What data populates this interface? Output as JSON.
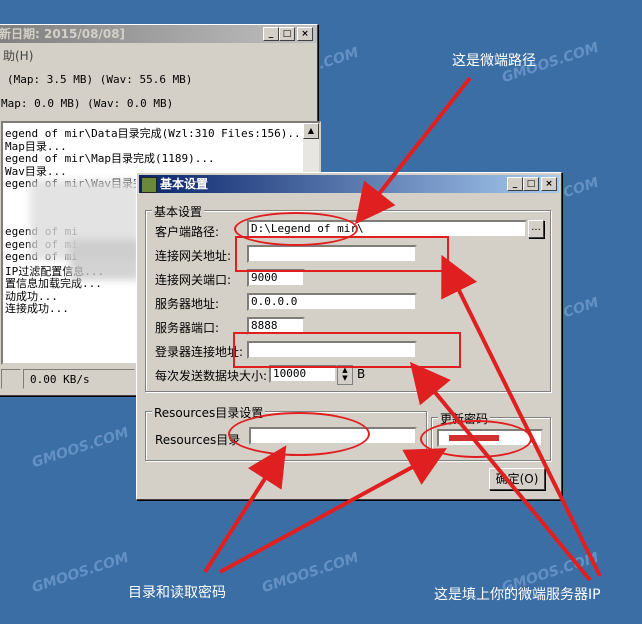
{
  "bg_window": {
    "title": "新日期: 2015/08/08]",
    "menu": "助(H)",
    "stat1": "(Map: 3.5 MB) (Wav: 55.6 MB)",
    "stat2": "Map: 0.0 MB) (Wav: 0.0 MB)",
    "log": [
      "egend of mir\\Data目录完成(Wzl:310 Files:156)...",
      "Map目录...",
      "egend of mir\\Map目录完成(1189)...",
      "Wav目录...",
      "egend of mir\\Wav目录完成(",
      "",
      "",
      "",
      "egend of mi",
      "egend of mi",
      "egend of mi",
      "IP过滤配置信息...",
      "置信息加载完成...",
      "动成功...",
      "连接成功..."
    ],
    "speed": "0.00 KB/s"
  },
  "dialog": {
    "title": "基本设置",
    "basic_group": "基本设置",
    "client_path_label": "客户端路径:",
    "client_path_value": "D:\\Legend of mir\\",
    "browse_btn": "...",
    "gateway_addr_label": "连接网关地址:",
    "gateway_addr_value": "",
    "gateway_port_label": "连接网关端口:",
    "gateway_port_value": "9000",
    "server_addr_label": "服务器地址:",
    "server_addr_value": "0.0.0.0",
    "server_port_label": "服务器端口:",
    "server_port_value": "8888",
    "login_addr_label": "登录器连接地址:",
    "login_addr_value": "",
    "block_size_label": "每次发送数据块大小:",
    "block_size_value": "10000",
    "block_unit": "B",
    "res_group": "Resources目录设置",
    "res_dir_label": "Resources目录",
    "res_dir_value": "",
    "pwd_group": "更新密码",
    "ok_btn": "确定(O)"
  },
  "annotations": {
    "top": "这是微端路径",
    "bottom_left": "目录和读取密码",
    "bottom_right": "这是填上你的微端服务器IP"
  },
  "watermark": "GMOOS.COM",
  "colors": {
    "desktop": "#3a6ea5",
    "annotation_red": "#e02020"
  }
}
